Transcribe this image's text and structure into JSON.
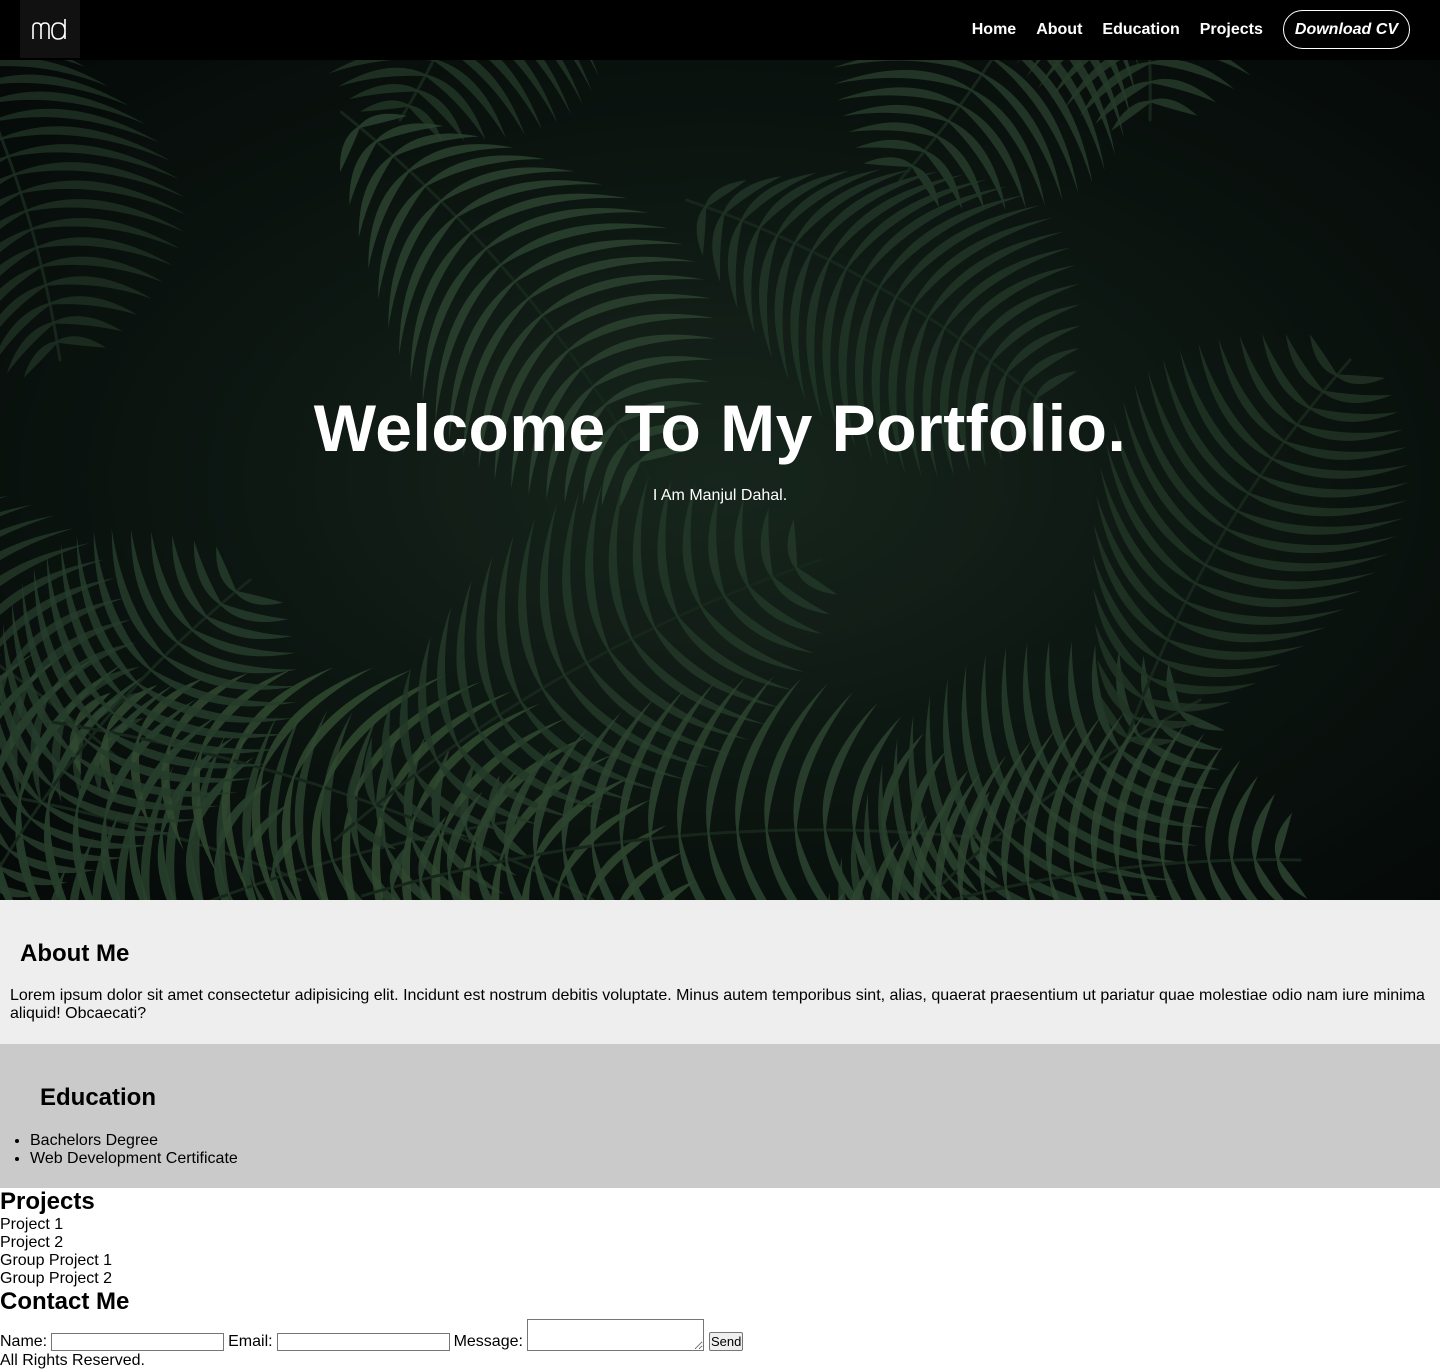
{
  "nav": {
    "logo_text": "md",
    "links": [
      "Home",
      "About",
      "Education",
      "Projects"
    ],
    "cv_button": "Download CV"
  },
  "hero": {
    "title": "Welcome To My Portfolio.",
    "subtitle": "I Am Manjul Dahal."
  },
  "about": {
    "heading": "About Me",
    "text": "Lorem ipsum dolor sit amet consectetur adipisicing elit. Incidunt est nostrum debitis voluptate. Minus autem temporibus sint, alias, quaerat praesentium ut pariatur quae molestiae odio nam iure minima aliquid! Obcaecati?"
  },
  "education": {
    "heading": "Education",
    "items": [
      "Bachelors Degree",
      "Web Development Certificate"
    ]
  },
  "projects": {
    "heading": "Projects",
    "items": [
      "Project 1",
      "Project 2",
      "Group Project 1",
      "Group Project 2"
    ]
  },
  "contact": {
    "heading": "Contact Me",
    "name_label": "Name:",
    "email_label": "Email:",
    "message_label": "Message:",
    "name_value": "",
    "email_value": "",
    "send_button": "Send"
  },
  "footer": {
    "text": "All Rights Reserved."
  },
  "colors": {
    "nav_bg": "#000000",
    "about_bg": "#eeeeee",
    "education_bg": "#cacaca"
  }
}
